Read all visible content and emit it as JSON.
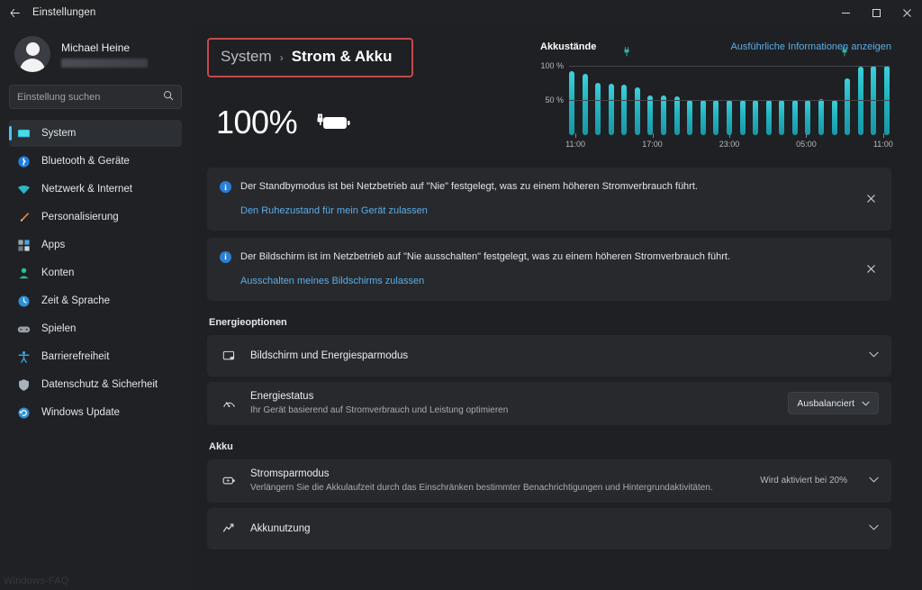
{
  "titlebar": {
    "back_icon": "arrow-left-icon",
    "title": "Einstellungen",
    "minimize_label": "–",
    "maximize_label": "□",
    "close_label": "✕"
  },
  "sidebar": {
    "profile": {
      "name": "Michael Heine",
      "email_masked": ""
    },
    "search": {
      "placeholder": "Einstellung suchen",
      "value": "",
      "icon": "search-icon"
    },
    "items": [
      {
        "label": "System",
        "icon": "monitor-icon",
        "active": true
      },
      {
        "label": "Bluetooth & Geräte",
        "icon": "bluetooth-icon",
        "active": false
      },
      {
        "label": "Netzwerk & Internet",
        "icon": "wifi-icon",
        "active": false
      },
      {
        "label": "Personalisierung",
        "icon": "brush-icon",
        "active": false
      },
      {
        "label": "Apps",
        "icon": "apps-icon",
        "active": false
      },
      {
        "label": "Konten",
        "icon": "person-icon",
        "active": false
      },
      {
        "label": "Zeit & Sprache",
        "icon": "clock-icon",
        "active": false
      },
      {
        "label": "Spielen",
        "icon": "gamepad-icon",
        "active": false
      },
      {
        "label": "Barrierefreiheit",
        "icon": "accessibility-icon",
        "active": false
      },
      {
        "label": "Datenschutz & Sicherheit",
        "icon": "shield-icon",
        "active": false
      },
      {
        "label": "Windows Update",
        "icon": "update-icon",
        "active": false
      }
    ],
    "watermark": "Windows-FAQ"
  },
  "header": {
    "breadcrumb_root": "System",
    "breadcrumb_sep": "›",
    "breadcrumb_current": "Strom & Akku",
    "highlight_color": "#c4484a"
  },
  "battery": {
    "percent_label": "100%",
    "icon": "battery-charging-icon"
  },
  "chart_data": {
    "type": "bar",
    "title": "Akkustände",
    "link_label": "Ausführliche Informationen anzeigen",
    "xlabel": "",
    "ylabel": "",
    "ylim": [
      0,
      110
    ],
    "grid": true,
    "legend": "none",
    "ytick_labels": [
      "100 %",
      "50 %"
    ],
    "ytick_values": [
      100,
      50
    ],
    "xtick_labels": [
      "11:00",
      "17:00",
      "23:00",
      "05:00",
      "11:00"
    ],
    "xtick_positions": [
      0,
      6,
      12,
      18,
      24
    ],
    "bar_color": "#28b8c4",
    "categories": [
      "11:00",
      "12:00",
      "13:00",
      "14:00",
      "15:00",
      "16:00",
      "17:00",
      "18:00",
      "19:00",
      "20:00",
      "21:00",
      "22:00",
      "23:00",
      "00:00",
      "01:00",
      "02:00",
      "03:00",
      "04:00",
      "05:00",
      "06:00",
      "07:00",
      "08:00",
      "09:00",
      "10:00",
      "11:00"
    ],
    "values": [
      92,
      88,
      75,
      74,
      73,
      69,
      57,
      57,
      56,
      50,
      50,
      50,
      50,
      50,
      50,
      50,
      50,
      50,
      50,
      52,
      50,
      82,
      99,
      100,
      100
    ],
    "annotations": [
      {
        "label": "charging-plug-icon",
        "x_index": 4
      },
      {
        "label": "charging-plug-icon",
        "x_index": 21
      }
    ]
  },
  "banners": [
    {
      "icon": "info-icon",
      "text": "Der Standbymodus ist bei Netzbetrieb auf \"Nie\" festgelegt, was zu einem höheren Stromverbrauch führt.",
      "link": "Den Ruhezustand für mein Gerät zulassen",
      "close_label": "✕"
    },
    {
      "icon": "info-icon",
      "text": "Der Bildschirm ist im Netzbetrieb auf \"Nie ausschalten\" festgelegt, was zu einem höheren Stromverbrauch führt.",
      "link": "Ausschalten meines Bildschirms zulassen",
      "close_label": "✕"
    }
  ],
  "sections": [
    {
      "title": "Energieoptionen",
      "rows": [
        {
          "icon": "screen-sleep-icon",
          "title": "Bildschirm und Energiesparmodus",
          "subtitle": "",
          "value": "",
          "chevron": "⌄"
        },
        {
          "icon": "gauge-icon",
          "title": "Energiestatus",
          "subtitle": "Ihr Gerät basierend auf Stromverbrauch und Leistung optimieren",
          "value": "Ausbalanciert",
          "chevron": "⌄"
        }
      ]
    },
    {
      "title": "Akku",
      "rows": [
        {
          "icon": "battery-saver-icon",
          "title": "Stromsparmodus",
          "subtitle": "Verlängern Sie die Akkulaufzeit durch das Einschränken bestimmter Benachrichtigungen und Hintergrundaktivitäten.",
          "value": "Wird aktiviert bei 20%",
          "chevron": "⌄"
        },
        {
          "icon": "chart-line-icon",
          "title": "Akkunutzung",
          "subtitle": "",
          "value": "",
          "chevron": "⌄"
        }
      ]
    }
  ]
}
